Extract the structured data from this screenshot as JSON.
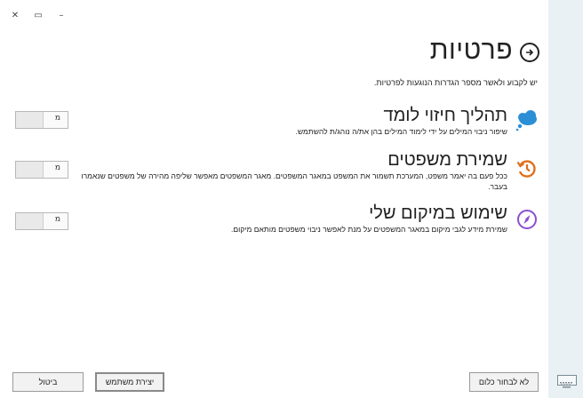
{
  "window": {
    "close_glyph": "✕",
    "restore_glyph": "▭",
    "minimize_glyph": "–"
  },
  "header": {
    "title": "פרטיות",
    "back_icon": "arrow-right-circle-icon",
    "subtitle": "יש לקבוע ולאשר מספר הגדרות הנוגעות לפרטיות."
  },
  "settings": [
    {
      "title": "תהליך חיזוי לומד",
      "description": "שיפור ניבוי המילים על ידי לימוד המילים בהן את/ה נוהג/ת להשתמש.",
      "icon": "cloud-thought-icon",
      "icon_color": "#2b8fd6",
      "toggle_label": "מ"
    },
    {
      "title": "שמירת משפטים",
      "description": "ככל פעם בה יאמר משפט, המערכת תשמור  את המשפט במאגר המשפטים. מאגר המשפטים מאפשר שליפה מהירה של משפטים שנאמרו בעבר.",
      "icon": "history-clock-icon",
      "icon_color": "#e0701c",
      "toggle_label": "מ"
    },
    {
      "title": "שימוש במיקום שלי",
      "description": "שמירת מידע לגבי מיקום במאגר המשפטים על מנת לאפשר ניבוי משפטים מותאם מיקום.",
      "icon": "compass-icon",
      "icon_color": "#8a4fd1",
      "toggle_label": "מ"
    }
  ],
  "footer": {
    "select_all_label": "לא לבחור כלום",
    "create_user_label": "יצירת משתמש",
    "cancel_label": "ביטול"
  },
  "system": {
    "keyboard_icon": "keyboard-icon"
  }
}
